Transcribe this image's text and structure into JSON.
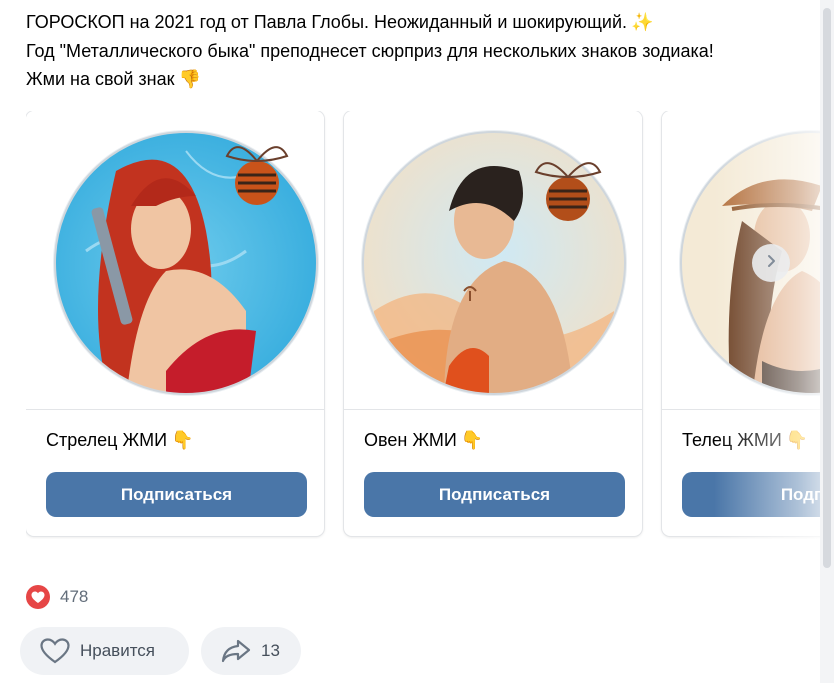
{
  "post": {
    "line1": "ГОРОСКОП на 2021 год от Павла Глобы. Неожиданный и шокирующий.",
    "line2": "Год \"Металлического быка\" преподнесет сюрприз для нескольких знаков зодиака!",
    "line3": "Жми на свой знак",
    "sparkle_emoji": "✨",
    "finger_emoji": "👎"
  },
  "cards": [
    {
      "title": "Стрелец ЖМИ",
      "emoji": "👇",
      "button": "Подписаться"
    },
    {
      "title": "Овен ЖМИ",
      "emoji": "👇",
      "button": "Подписаться"
    },
    {
      "title": "Телец ЖМИ",
      "emoji": "👇",
      "button": "Подпис"
    }
  ],
  "reactions": {
    "likes_count": "478"
  },
  "actions": {
    "like_label": "Нравится",
    "share_count": "13"
  },
  "colors": {
    "button": "#4a76a8",
    "heart": "#e64646",
    "action_bg": "#f0f2f5"
  },
  "icons": [
    "sparkles-icon",
    "hand-down-icon",
    "chevron-right-icon",
    "heart-icon",
    "share-arrow-icon"
  ]
}
